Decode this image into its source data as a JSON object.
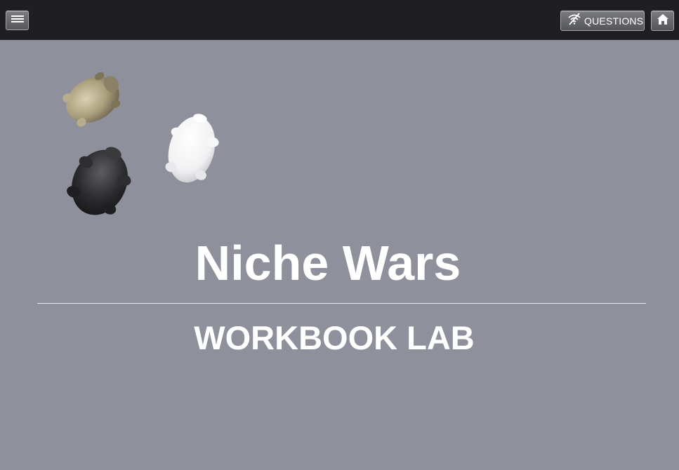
{
  "header": {
    "menu_icon": "hamburger-menu-icon",
    "questions_icon": "no-signal-icon",
    "questions_label": "QUESTIONS",
    "home_icon": "home-icon"
  },
  "main": {
    "title": "Niche Wars",
    "subtitle": "WORKBOOK LAB"
  },
  "colors": {
    "background": "#8e909b",
    "topbar": "#1f1f21",
    "text": "#ffffff"
  }
}
